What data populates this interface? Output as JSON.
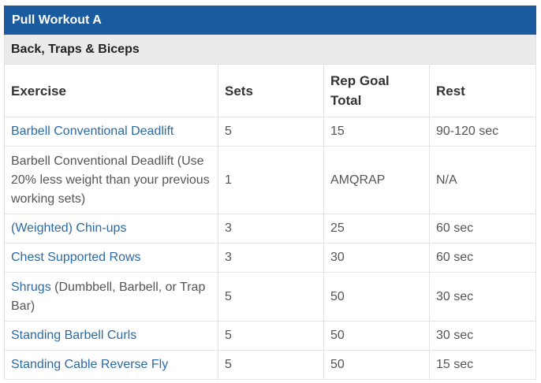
{
  "table": {
    "title": "Pull Workout A",
    "subtitle": "Back, Traps & Biceps",
    "headers": [
      "Exercise",
      "Sets",
      "Rep Goal Total",
      "Rest"
    ],
    "rows": [
      {
        "exercise_link": "Barbell Conventional Deadlift",
        "exercise_extra": "",
        "sets": "5",
        "reps": "15",
        "rest": "90-120 sec"
      },
      {
        "exercise_link": "",
        "exercise_extra": "Barbell Conventional Deadlift (Use 20% less weight than your previous working sets)",
        "sets": "1",
        "reps": "AMQRAP",
        "rest": "N/A"
      },
      {
        "exercise_link": "(Weighted) Chin-ups",
        "exercise_extra": "",
        "sets": "3",
        "reps": "25",
        "rest": "60 sec"
      },
      {
        "exercise_link": "Chest Supported Rows",
        "exercise_extra": "",
        "sets": "3",
        "reps": "30",
        "rest": "60 sec"
      },
      {
        "exercise_link": "Shrugs",
        "exercise_extra": " (Dumbbell, Barbell, or Trap Bar)",
        "sets": "5",
        "reps": "50",
        "rest": "30 sec"
      },
      {
        "exercise_link": "Standing Barbell Curls",
        "exercise_extra": "",
        "sets": "5",
        "reps": "50",
        "rest": "30 sec"
      },
      {
        "exercise_link": "Standing Cable Reverse Fly",
        "exercise_extra": "",
        "sets": "5",
        "reps": "50",
        "rest": "15 sec"
      }
    ]
  },
  "colors": {
    "title_bg": "#1a5a9f",
    "subtitle_bg": "#ebebeb",
    "link": "#2b6aa5",
    "text": "#555555"
  }
}
